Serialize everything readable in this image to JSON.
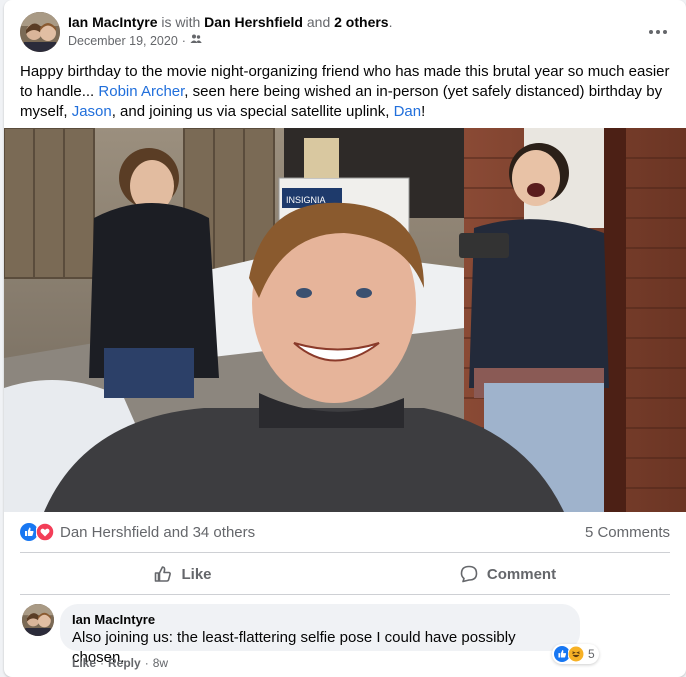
{
  "post": {
    "author": "Ian MacIntyre",
    "with_text": "is with",
    "tagged": "Dan Hershfield",
    "and_text": "and",
    "others": "2 others",
    "period": ".",
    "date": "December 19, 2020",
    "date_sep": "·",
    "privacy_icon": "friends-icon",
    "text": {
      "part1": "Happy birthday to the movie night-organizing friend who has made this brutal year so much easier to handle... ",
      "link1": "Robin Archer",
      "part2": ", seen here being wished an in-person (yet safely distanced) birthday by myself, ",
      "link2": "Jason",
      "part3": ", and joining us via special satellite uplink, ",
      "link3": "Dan",
      "part4": "!"
    }
  },
  "photo": {
    "box_text": "INSIGNIA"
  },
  "reactions": {
    "icons": [
      "like-icon",
      "love-icon"
    ],
    "summary": "Dan Hershfield and 34 others",
    "comments": "5 Comments"
  },
  "actions": {
    "like": "Like",
    "comment": "Comment"
  },
  "comment": {
    "author": "Ian MacIntyre",
    "text": "Also joining us: the least-flattering selfie pose I could have possibly chosen.",
    "like": "Like",
    "sep": "·",
    "reply": "Reply",
    "time": "8w",
    "reaction_count": "5",
    "reaction_icons": [
      "like-icon",
      "haha-icon"
    ]
  },
  "colors": {
    "link": "#216fdb",
    "like_blue": "#1877f2",
    "love_red": "#f33e58",
    "haha_yellow": "#f7b125"
  }
}
